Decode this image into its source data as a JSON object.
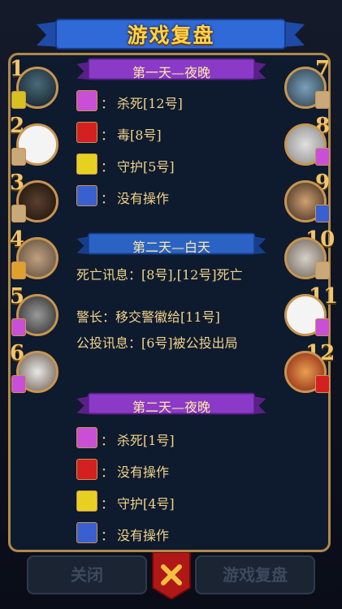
{
  "header": {
    "title": "游戏复盘"
  },
  "seats_left": [
    {
      "num": "1"
    },
    {
      "num": "2"
    },
    {
      "num": "3"
    },
    {
      "num": "4"
    },
    {
      "num": "5"
    },
    {
      "num": "6"
    }
  ],
  "seats_right": [
    {
      "num": "7"
    },
    {
      "num": "8"
    },
    {
      "num": "9"
    },
    {
      "num": "10"
    },
    {
      "num": "11"
    },
    {
      "num": "12"
    }
  ],
  "sections": [
    {
      "title": "第一天—夜晚",
      "actions": [
        {
          "icon": "wolf-claw-icon",
          "color": "#c94fd6",
          "text": "杀死[12号]"
        },
        {
          "icon": "poison-icon",
          "color": "#d42020",
          "text": "毒[8号]"
        },
        {
          "icon": "guard-shield-icon",
          "color": "#e8d020",
          "text": "守护[5号]"
        },
        {
          "icon": "seer-eye-icon",
          "color": "#3a5fd0",
          "text": "没有操作"
        }
      ]
    },
    {
      "title": "第二天—白天",
      "info": [
        {
          "text": "死亡讯息：[8号],[12号]死亡"
        },
        {
          "text": "警长：移交警徽给[11号]"
        },
        {
          "text": "公投讯息：[6号]被公投出局"
        }
      ]
    },
    {
      "title": "第二天—夜晚",
      "actions": [
        {
          "icon": "wolf-claw-icon",
          "color": "#c94fd6",
          "text": "杀死[1号]"
        },
        {
          "icon": "poison-icon",
          "color": "#d42020",
          "text": "没有操作"
        },
        {
          "icon": "guard-shield-icon",
          "color": "#e8d020",
          "text": "守护[4号]"
        },
        {
          "icon": "seer-eye-icon",
          "color": "#3a5fd0",
          "text": "没有操作"
        }
      ]
    }
  ],
  "colon": "：",
  "footer": {
    "close_label": "关闭",
    "review_label": "游戏复盘"
  },
  "colors": {
    "gold": "#c89550",
    "purple_ribbon": "#7b2fb0",
    "blue_ribbon": "#2a63c4"
  }
}
